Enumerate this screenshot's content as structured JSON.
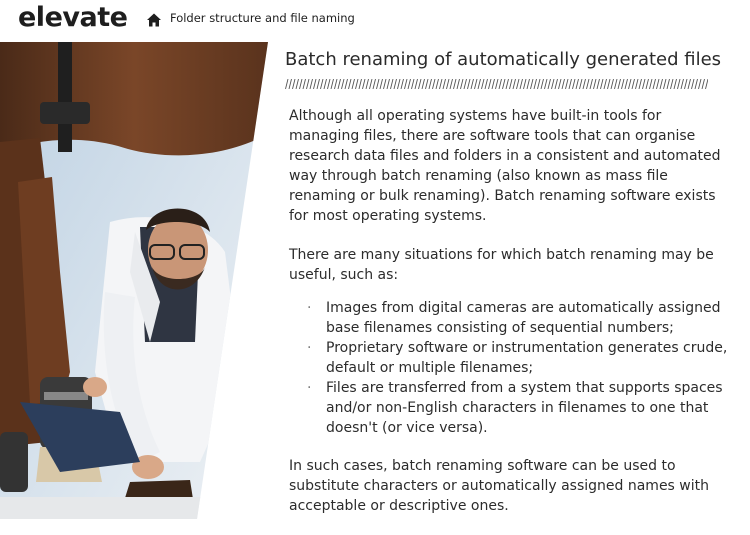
{
  "header": {
    "logo": "elevate",
    "breadcrumb": "Folder structure and file naming",
    "home_icon": "home-icon"
  },
  "page": {
    "title": "Batch renaming of automatically generated files",
    "intro": "Although all operating systems have built-in tools for managing files, there are software tools that can organise research data files and folders in a consistent and automated way through batch renaming (also known as mass file renaming or bulk renaming). Batch renaming software exists for most operating systems.",
    "lead": "There are many situations for which batch renaming may be useful, such as:",
    "bullets": [
      "Images from digital cameras are automatically assigned base filenames consisting of sequential numbers;",
      "Proprietary software or instrumentation generates crude, default or multiple filenames;",
      "Files are transferred from a system that supports spaces and/or non-English characters in filenames to one that doesn't (or vice versa)."
    ],
    "bullet_char": "·",
    "conclusion": "In such cases, batch renaming software can be used to substitute characters or automatically assigned names with acceptable or descriptive ones."
  },
  "colors": {
    "text": "#2c2c2c",
    "rule": "#555555"
  }
}
